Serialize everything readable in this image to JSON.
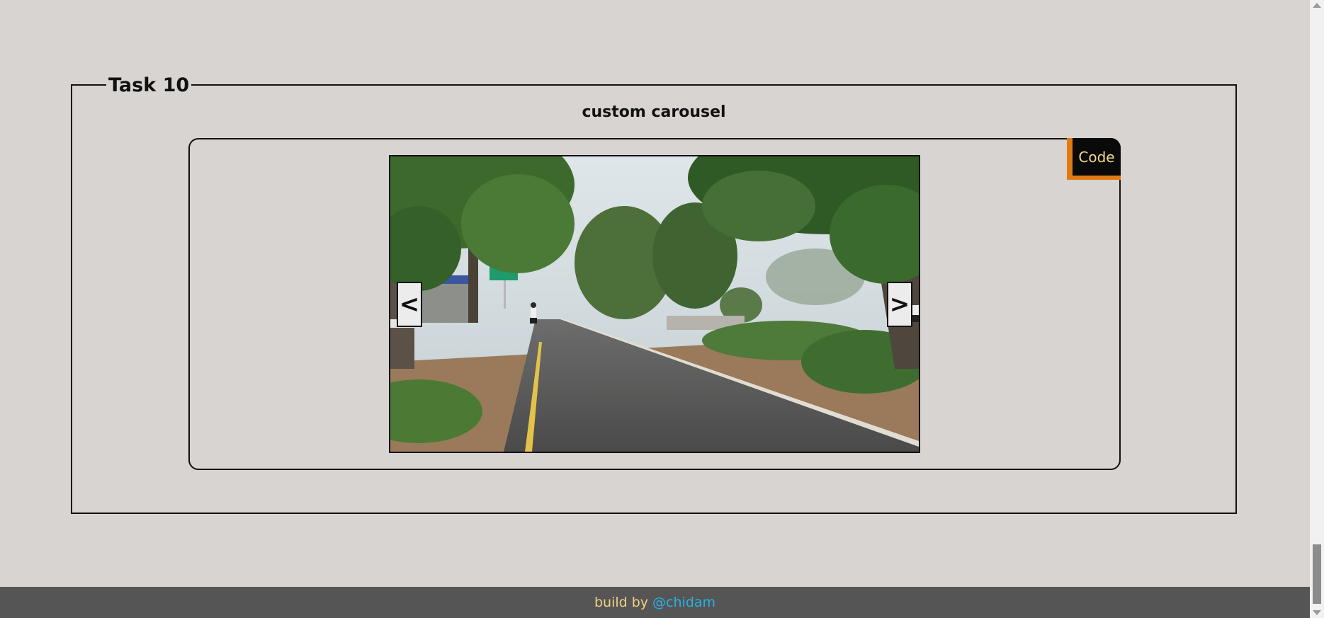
{
  "task": {
    "legend": "Task 10",
    "subtitle": "custom carousel"
  },
  "carousel": {
    "code_label": "Code",
    "prev_label": "<",
    "next_label": ">",
    "image_alt": "tree-lined rural road with motorcyclist"
  },
  "footer": {
    "text": "build by",
    "link": "@chidam"
  },
  "colors": {
    "background": "#d8d4d1",
    "code_tab_bg": "#0a0a0a",
    "code_tab_accent": "#e07a12",
    "code_tab_text": "#f5d889",
    "footer_bg": "#555555",
    "footer_text": "#f3d27e",
    "footer_link": "#27b2e6"
  }
}
